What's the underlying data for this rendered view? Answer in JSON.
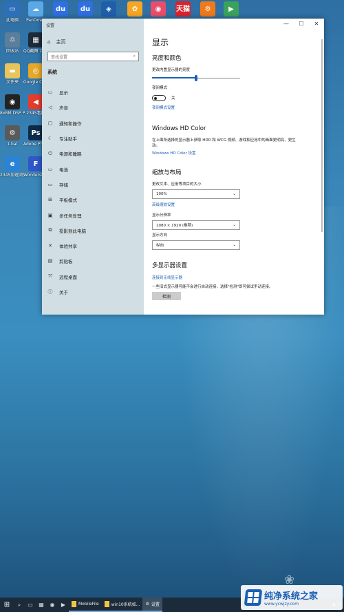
{
  "desktop": {
    "icons": [
      {
        "label": "此电脑",
        "icon": "computer-icon",
        "color": "#2d6fb8",
        "glyph": "▭"
      },
      {
        "label": "PanDown",
        "icon": "cloud-icon",
        "color": "#5aa9e6",
        "glyph": "☁"
      },
      {
        "label": "",
        "icon": "baidu-icon",
        "color": "#2f6fe0",
        "glyph": "du"
      },
      {
        "label": "",
        "icon": "baidu-icon",
        "color": "#2f6fe0",
        "glyph": "du"
      },
      {
        "label": "",
        "icon": "layers-icon",
        "color": "#1f5faa",
        "glyph": "◈"
      },
      {
        "label": "",
        "icon": "app-icon",
        "color": "#f5a623",
        "glyph": "✿"
      },
      {
        "label": "",
        "icon": "app-icon",
        "color": "#e84d6a",
        "glyph": "◉"
      },
      {
        "label": "",
        "icon": "tmall-icon",
        "color": "#d9232d",
        "glyph": "天猫"
      },
      {
        "label": "",
        "icon": "gear-icon",
        "color": "#f07a1a",
        "glyph": "⚙"
      },
      {
        "label": "",
        "icon": "play-store-icon",
        "color": "#3aa35b",
        "glyph": "▶"
      },
      {
        "label": "回收站",
        "icon": "recycle-bin-icon",
        "color": "#5b7f9a",
        "glyph": "♲"
      },
      {
        "label": "QQ截图 2020061...",
        "icon": "image-icon",
        "color": "#1d2a38",
        "glyph": "▦"
      },
      {
        "label": "文件夹",
        "icon": "folder-icon",
        "color": "#e8c45a",
        "glyph": "▬"
      },
      {
        "label": "Google Chrome",
        "icon": "chrome-icon",
        "color": "#e5a82b",
        "glyph": "◎"
      },
      {
        "label": "8xBM DSP Processor ...",
        "icon": "speaker-icon",
        "color": "#222",
        "glyph": "◉"
      },
      {
        "label": "2345看图",
        "icon": "volume-icon",
        "color": "#e23c2c",
        "glyph": "◀"
      },
      {
        "label": "1.bat",
        "icon": "bat-icon",
        "color": "#5a5a5a",
        "glyph": "⚙"
      },
      {
        "label": "Adobe Photosh...",
        "icon": "photoshop-icon",
        "color": "#0e2a4a",
        "glyph": "Ps"
      },
      {
        "label": "2345加速浏览器",
        "icon": "browser-icon",
        "color": "#2a84d6",
        "glyph": "e"
      },
      {
        "label": "Wondershare PDFelem...",
        "icon": "pdf-icon",
        "color": "#2f57c8",
        "glyph": "F"
      }
    ]
  },
  "settings": {
    "window_title": "设置",
    "home_label": "主页",
    "search_placeholder": "查找设置",
    "section_title": "系统",
    "nav": [
      {
        "label": "显示",
        "icon": "monitor-icon",
        "glyph": "▭"
      },
      {
        "label": "声音",
        "icon": "speaker-icon",
        "glyph": "◁"
      },
      {
        "label": "通知和操作",
        "icon": "notification-icon",
        "glyph": "▢"
      },
      {
        "label": "专注助手",
        "icon": "moon-icon",
        "glyph": "☾"
      },
      {
        "label": "电源和睡眠",
        "icon": "power-icon",
        "glyph": "⏻"
      },
      {
        "label": "电池",
        "icon": "battery-icon",
        "glyph": "▭"
      },
      {
        "label": "存储",
        "icon": "storage-icon",
        "glyph": "▭"
      },
      {
        "label": "平板模式",
        "icon": "tablet-icon",
        "glyph": "⊞"
      },
      {
        "label": "多任务处理",
        "icon": "multitask-icon",
        "glyph": "▣"
      },
      {
        "label": "投影到此电脑",
        "icon": "project-icon",
        "glyph": "⧉"
      },
      {
        "label": "体验共享",
        "icon": "share-icon",
        "glyph": "✕"
      },
      {
        "label": "剪贴板",
        "icon": "clipboard-icon",
        "glyph": "▤"
      },
      {
        "label": "远程桌面",
        "icon": "remote-icon",
        "glyph": "⤧"
      },
      {
        "label": "关于",
        "icon": "info-icon",
        "glyph": "ⓘ"
      }
    ],
    "window_controls": {
      "minimize": "—",
      "maximize": "☐",
      "close": "✕"
    },
    "page_title": "显示",
    "brightness": {
      "heading": "亮度和颜色",
      "slider_label": "更改内置显示器的亮度",
      "level": 0.5,
      "night_light_label": "夜间模式",
      "night_light_state": "关",
      "night_light_link": "夜间模式设置"
    },
    "hdr": {
      "heading": "Windows HD Color",
      "description": "在上面所选择的显示器上获取 HDR 和 WCG 视频、游戏和应用中的画面更明亮、更生动。",
      "link": "Windows HD Color 设置"
    },
    "scale": {
      "heading": "缩放与布局",
      "scale_label": "更改文本、应用等项目的大小",
      "scale_value": "100%",
      "advanced_link": "高级缩放设置",
      "resolution_label": "显示分辨率",
      "resolution_value": "1080 × 1920 (推荐)",
      "orientation_label": "显示方向",
      "orientation_value": "纵向"
    },
    "multi": {
      "heading": "多显示器设置",
      "wireless_link": "连接到无线显示器",
      "note": "一些旧式显示器可能不会进行自动连接，选择\"检测\"即可尝试手动连接。",
      "detect_button": "检测"
    }
  },
  "taskbar": {
    "start_icon": "windows-icon",
    "apps": [
      {
        "label": "MobileFile",
        "icon": "folder-icon"
      },
      {
        "label": "win10系统如...",
        "icon": "folder-icon"
      },
      {
        "label": "设置",
        "icon": "gear-icon"
      }
    ]
  },
  "watermark": {
    "main": "纯净系统之家",
    "sub": "www.ycwjzy.com"
  }
}
